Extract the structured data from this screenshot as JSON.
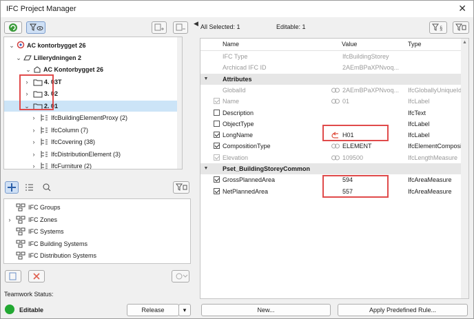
{
  "window": {
    "title": "IFC Project Manager"
  },
  "left_toolbar": {
    "refresh_tip": "",
    "filter_tip": ""
  },
  "tree": {
    "items": [
      {
        "label": "AC kontorbygget 26",
        "level": 0,
        "bold": true
      },
      {
        "label": "Lillerydningen 2",
        "level": 1,
        "bold": true
      },
      {
        "label": "AC Kontorbygget 26",
        "level": 2,
        "bold": true
      },
      {
        "label": "4. 03T",
        "level": 3,
        "bold": true
      },
      {
        "label": "3. 02",
        "level": 3,
        "bold": true
      },
      {
        "label": "2. 01",
        "level": 3,
        "bold": true
      },
      {
        "label": "IfcBuildingElementProxy (2)",
        "level": 4
      },
      {
        "label": "IfcColumn (7)",
        "level": 4
      },
      {
        "label": "IfcCovering (38)",
        "level": 4
      },
      {
        "label": "IfcDistributionElement (3)",
        "level": 4
      },
      {
        "label": "IfcFurniture (2)",
        "level": 4
      }
    ]
  },
  "groups": {
    "items": [
      {
        "label": "IFC Groups"
      },
      {
        "label": "IFC Zones"
      },
      {
        "label": "IFC Systems"
      },
      {
        "label": "IFC Building Systems"
      },
      {
        "label": "IFC Distribution Systems"
      }
    ]
  },
  "teamwork": {
    "label": "Teamwork Status:",
    "status": "Editable",
    "release": "Release",
    "status_color": "#22a832"
  },
  "header": {
    "selected": "All Selected: 1",
    "editable": "Editable: 1"
  },
  "properties": {
    "columns": [
      "Name",
      "Value",
      "Type"
    ],
    "rows": [
      {
        "kind": "prop",
        "name": "IFC Type",
        "value": "IfcBuildingStorey",
        "type": "",
        "gray": true,
        "checkbox": "none"
      },
      {
        "kind": "prop",
        "name": "Archicad IFC ID",
        "value": "2AEmBPaXPNvoq...",
        "type": "",
        "gray": true,
        "checkbox": "none"
      },
      {
        "kind": "section",
        "name": "Attributes"
      },
      {
        "kind": "prop",
        "name": "GlobalId",
        "value": "2AEmBPaXPNvoq...",
        "type": "IfcGloballyUniqueId",
        "gray": true,
        "checkbox": "none",
        "linkicon": true
      },
      {
        "kind": "prop",
        "name": "Name",
        "value": "01",
        "type": "IfcLabel",
        "gray": true,
        "checkbox": "dis-on",
        "linkicon": true
      },
      {
        "kind": "prop",
        "name": "Description",
        "value": "",
        "type": "IfcText",
        "gray": false,
        "checkbox": "off"
      },
      {
        "kind": "prop",
        "name": "ObjectType",
        "value": "",
        "type": "IfcLabel",
        "gray": false,
        "checkbox": "off"
      },
      {
        "kind": "prop",
        "name": "LongName",
        "value": "H01",
        "type": "IfcLabel",
        "gray": false,
        "checkbox": "on",
        "redicon": true
      },
      {
        "kind": "prop",
        "name": "CompositionType",
        "value": "ELEMENT",
        "type": "IfcElementComposi",
        "gray": false,
        "checkbox": "on",
        "linkicon": true
      },
      {
        "kind": "prop",
        "name": "Elevation",
        "value": "109500",
        "type": "IfcLengthMeasure",
        "gray": true,
        "checkbox": "dis-on",
        "linkicon": true
      },
      {
        "kind": "section",
        "name": "Pset_BuildingStoreyCommon"
      },
      {
        "kind": "prop",
        "name": "GrossPlannedArea",
        "value": "594",
        "type": "IfcAreaMeasure",
        "gray": false,
        "checkbox": "on"
      },
      {
        "kind": "prop",
        "name": "NetPlannedArea",
        "value": "557",
        "type": "IfcAreaMeasure",
        "gray": false,
        "checkbox": "on"
      }
    ]
  },
  "buttons": {
    "new": "New...",
    "apply_rule": "Apply Predefined Rule..."
  }
}
